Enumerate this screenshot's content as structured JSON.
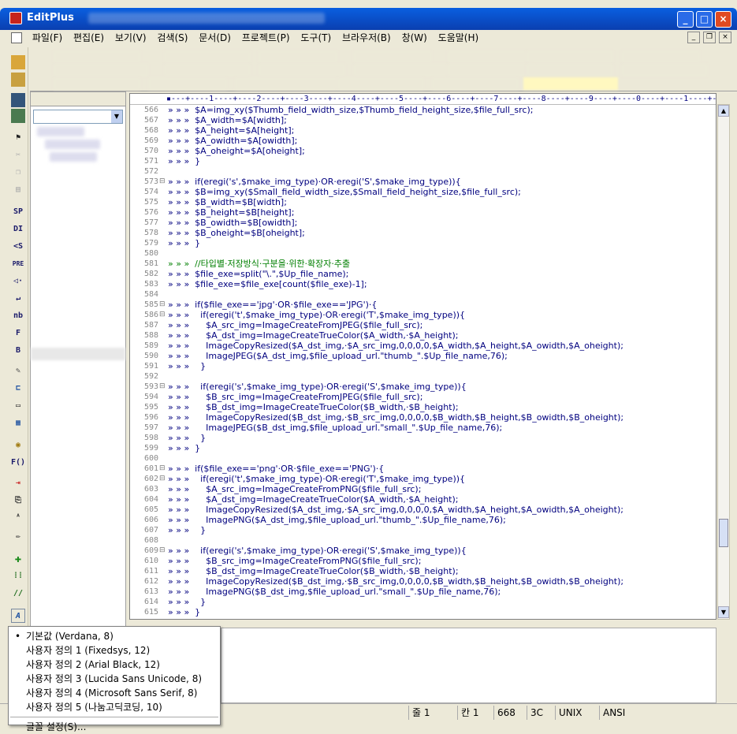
{
  "titlebar": {
    "app": "EditPlus",
    "buttons": [
      "_",
      "□",
      "×"
    ]
  },
  "menu": [
    "파일(F)",
    "편집(E)",
    "보기(V)",
    "검색(S)",
    "문서(D)",
    "프로젝트(P)",
    "도구(T)",
    "브라우저(B)",
    "창(W)",
    "도움말(H)"
  ],
  "mdi_buttons": [
    "_",
    "❐",
    "×"
  ],
  "toolbar_text_icons": [
    "SP",
    "DI",
    "<S",
    "PRE",
    "◁·",
    "↵",
    "nb",
    "F",
    "B"
  ],
  "toolbar_text_icons2": [
    "F()"
  ],
  "ruler": "▪---+----1----+----2----+----3----+----4----+----5----+----6----+----7----+----8----+----9----+----0----+----1----+-",
  "code_lines": [
    {
      "n": "566",
      "fold": "",
      "text": "» » »  $A=img_xy($Thumb_field_width_size,$Thumb_field_height_size,$file_full_src);"
    },
    {
      "n": "567",
      "fold": "",
      "text": "» » »  $A_width=$A[width];"
    },
    {
      "n": "568",
      "fold": "",
      "text": "» » »  $A_height=$A[height];"
    },
    {
      "n": "569",
      "fold": "",
      "text": "» » »  $A_owidth=$A[owidth];"
    },
    {
      "n": "570",
      "fold": "",
      "text": "» » »  $A_oheight=$A[oheight];"
    },
    {
      "n": "571",
      "fold": "",
      "text": "» » »  }"
    },
    {
      "n": "572",
      "fold": "",
      "text": ""
    },
    {
      "n": "573",
      "fold": "⊟",
      "text": "» » »  if(eregi('s',$make_img_type)·OR·eregi('S',$make_img_type)){"
    },
    {
      "n": "574",
      "fold": "",
      "text": "» » »  $B=img_xy($Small_field_width_size,$Small_field_height_size,$file_full_src);"
    },
    {
      "n": "575",
      "fold": "",
      "text": "» » »  $B_width=$B[width];"
    },
    {
      "n": "576",
      "fold": "",
      "text": "» » »  $B_height=$B[height];"
    },
    {
      "n": "577",
      "fold": "",
      "text": "» » »  $B_owidth=$B[owidth];"
    },
    {
      "n": "578",
      "fold": "",
      "text": "» » »  $B_oheight=$B[oheight];"
    },
    {
      "n": "579",
      "fold": "",
      "text": "» » »  }"
    },
    {
      "n": "580",
      "fold": "",
      "text": ""
    },
    {
      "n": "581",
      "fold": "",
      "text": "» » »  //타입별·저장방식·구분을·위한·확장자·추출",
      "comment": true
    },
    {
      "n": "582",
      "fold": "",
      "text": "» » »  $file_exe=split(\"\\.\",$Up_file_name);"
    },
    {
      "n": "583",
      "fold": "",
      "text": "» » »  $file_exe=$file_exe[count($file_exe)-1];"
    },
    {
      "n": "584",
      "fold": "",
      "text": ""
    },
    {
      "n": "585",
      "fold": "⊟",
      "text": "» » »  if($file_exe=='jpg'·OR·$file_exe=='JPG')·{"
    },
    {
      "n": "586",
      "fold": "⊟",
      "text": "» » »    if(eregi('t',$make_img_type)·OR·eregi('T',$make_img_type)){"
    },
    {
      "n": "587",
      "fold": "",
      "text": "» » »      $A_src_img=ImageCreateFromJPEG($file_full_src);"
    },
    {
      "n": "588",
      "fold": "",
      "text": "» » »      $A_dst_img=ImageCreateTrueColor($A_width,·$A_height);"
    },
    {
      "n": "589",
      "fold": "",
      "text": "» » »      ImageCopyResized($A_dst_img,·$A_src_img,0,0,0,0,$A_width,$A_height,$A_owidth,$A_oheight);"
    },
    {
      "n": "590",
      "fold": "",
      "text": "» » »      ImageJPEG($A_dst_img,$file_upload_url.\"thumb_\".$Up_file_name,76);"
    },
    {
      "n": "591",
      "fold": "",
      "text": "» » »    }"
    },
    {
      "n": "592",
      "fold": "",
      "text": ""
    },
    {
      "n": "593",
      "fold": "⊟",
      "text": "» » »    if(eregi('s',$make_img_type)·OR·eregi('S',$make_img_type)){"
    },
    {
      "n": "594",
      "fold": "",
      "text": "» » »      $B_src_img=ImageCreateFromJPEG($file_full_src);"
    },
    {
      "n": "595",
      "fold": "",
      "text": "» » »      $B_dst_img=ImageCreateTrueColor($B_width,·$B_height);"
    },
    {
      "n": "596",
      "fold": "",
      "text": "» » »      ImageCopyResized($B_dst_img,·$B_src_img,0,0,0,0,$B_width,$B_height,$B_owidth,$B_oheight);"
    },
    {
      "n": "597",
      "fold": "",
      "text": "» » »      ImageJPEG($B_dst_img,$file_upload_url.\"small_\".$Up_file_name,76);"
    },
    {
      "n": "598",
      "fold": "",
      "text": "» » »    }"
    },
    {
      "n": "599",
      "fold": "",
      "text": "» » »  }"
    },
    {
      "n": "600",
      "fold": "",
      "text": ""
    },
    {
      "n": "601",
      "fold": "⊟",
      "text": "» » »  if($file_exe=='png'·OR·$file_exe=='PNG')·{"
    },
    {
      "n": "602",
      "fold": "⊟",
      "text": "» » »    if(eregi('t',$make_img_type)·OR·eregi('T',$make_img_type)){"
    },
    {
      "n": "603",
      "fold": "",
      "text": "» » »      $A_src_img=ImageCreateFromPNG($file_full_src);"
    },
    {
      "n": "604",
      "fold": "",
      "text": "» » »      $A_dst_img=ImageCreateTrueColor($A_width,·$A_height);"
    },
    {
      "n": "605",
      "fold": "",
      "text": "» » »      ImageCopyResized($A_dst_img,·$A_src_img,0,0,0,0,$A_width,$A_height,$A_owidth,$A_oheight);"
    },
    {
      "n": "606",
      "fold": "",
      "text": "» » »      ImagePNG($A_dst_img,$file_upload_url.\"thumb_\".$Up_file_name,76);"
    },
    {
      "n": "607",
      "fold": "",
      "text": "» » »    }"
    },
    {
      "n": "608",
      "fold": "",
      "text": ""
    },
    {
      "n": "609",
      "fold": "⊟",
      "text": "» » »    if(eregi('s',$make_img_type)·OR·eregi('S',$make_img_type)){"
    },
    {
      "n": "610",
      "fold": "",
      "text": "» » »      $B_src_img=ImageCreateFromPNG($file_full_src);"
    },
    {
      "n": "611",
      "fold": "",
      "text": "» » »      $B_dst_img=ImageCreateTrueColor($B_width,·$B_height);"
    },
    {
      "n": "612",
      "fold": "",
      "text": "» » »      ImageCopyResized($B_dst_img,·$B_src_img,0,0,0,0,$B_width,$B_height,$B_owidth,$B_oheight);"
    },
    {
      "n": "613",
      "fold": "",
      "text": "» » »      ImagePNG($B_dst_img,$file_upload_url.\"small_\".$Up_file_name,76);"
    },
    {
      "n": "614",
      "fold": "",
      "text": "» » »    }"
    },
    {
      "n": "615",
      "fold": "",
      "text": "» » »  }"
    }
  ],
  "font_menu": {
    "items": [
      {
        "label": "기본값 (Verdana, 8)",
        "selected": true
      },
      {
        "label": "사용자 정의 1 (Fixedsys, 12)",
        "selected": false
      },
      {
        "label": "사용자 정의 2 (Arial Black, 12)",
        "selected": false
      },
      {
        "label": "사용자 정의 3 (Lucida Sans Unicode, 8)",
        "selected": false
      },
      {
        "label": "사용자 정의 4 (Microsoft Sans Serif, 8)",
        "selected": false
      },
      {
        "label": "사용자 정의 5 (나눔고딕코딩, 10)",
        "selected": false
      }
    ],
    "bullet": "•",
    "footer": "글꼴 설정(S)..."
  },
  "status": {
    "line": "줄 1",
    "col": "칸 1",
    "num": "668",
    "hex": "3C",
    "eol": "UNIX",
    "enc": "ANSI"
  },
  "scroll": {
    "up": "▲",
    "down": "▼",
    "drive_arrow": "▼"
  },
  "colors": {
    "titlebar": "#0a5fe0",
    "code": "#00007f",
    "comment": "#007f00"
  }
}
